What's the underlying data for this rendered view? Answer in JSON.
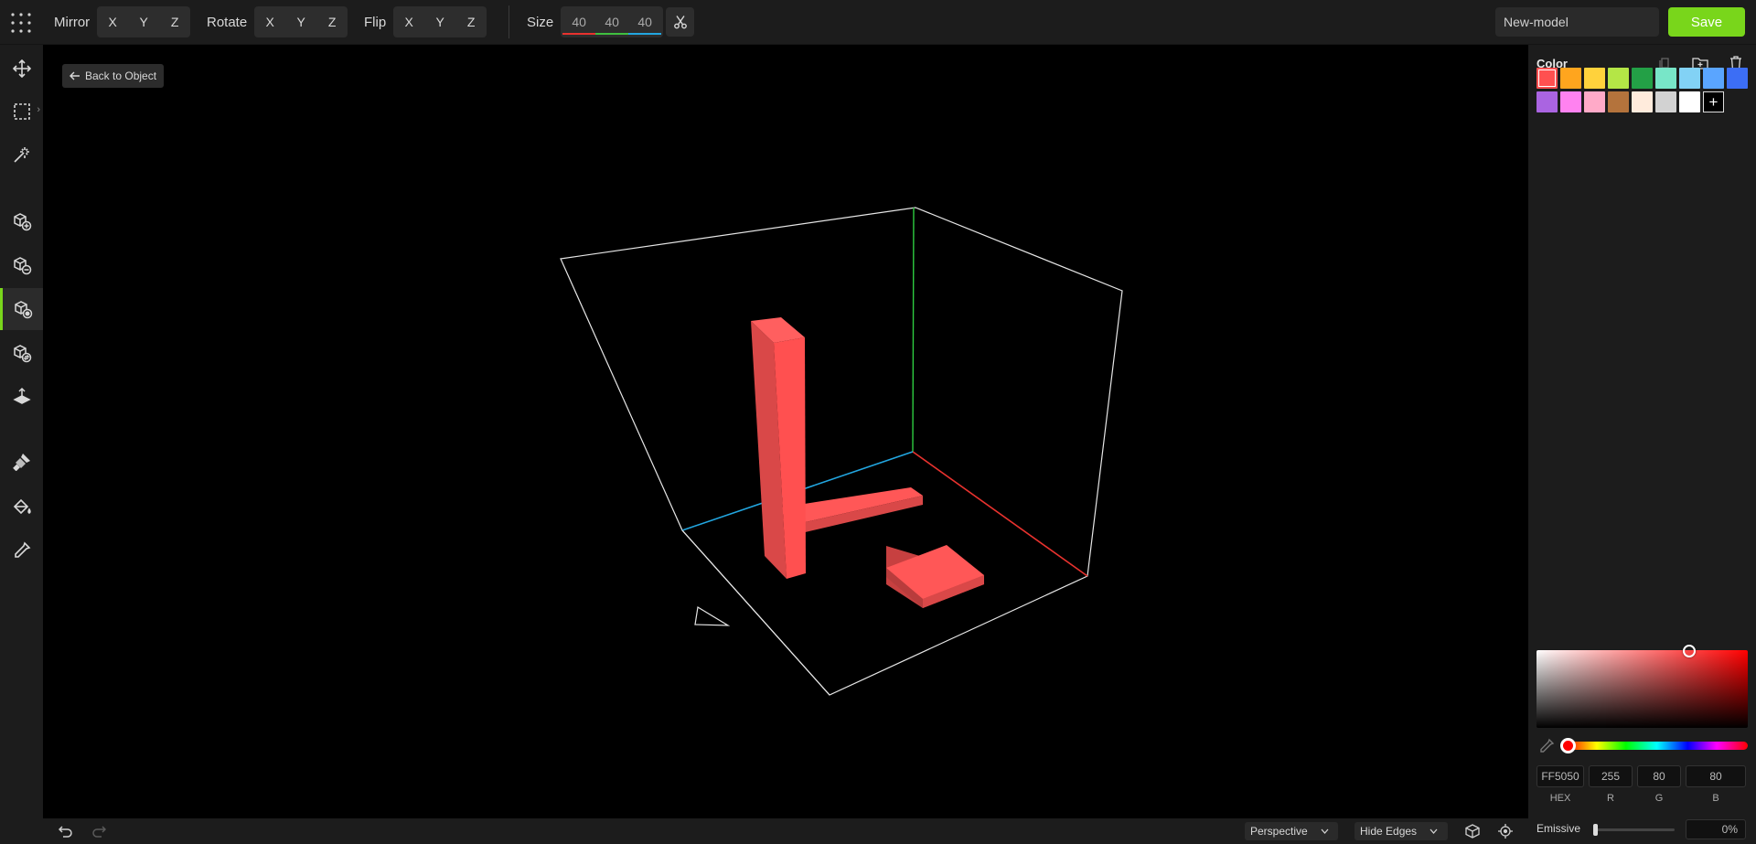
{
  "toolbar": {
    "mirror_label": "Mirror",
    "rotate_label": "Rotate",
    "flip_label": "Flip",
    "size_label": "Size",
    "axes": [
      "X",
      "Y",
      "Z"
    ],
    "size": {
      "x": "40",
      "y": "40",
      "z": "40"
    },
    "axis_colors": {
      "x": "#e8322e",
      "y": "#3fbf3f",
      "z": "#22a6e0"
    },
    "model_name": "New-model",
    "save_label": "Save"
  },
  "sidebar": {
    "tools": [
      {
        "icon": "move-icon"
      },
      {
        "icon": "select-box-icon"
      },
      {
        "icon": "magic-wand-icon"
      },
      {
        "icon": "add-voxel-icon"
      },
      {
        "icon": "remove-voxel-icon"
      },
      {
        "icon": "paint-voxel-icon",
        "active": true
      },
      {
        "icon": "replace-voxel-icon"
      },
      {
        "icon": "extrude-icon"
      },
      {
        "icon": "brush-icon"
      },
      {
        "icon": "fill-bucket-icon"
      },
      {
        "icon": "eyedropper-icon"
      }
    ]
  },
  "viewport": {
    "back_label": "Back to Object",
    "object_color": "#ff5050"
  },
  "bottombar": {
    "camera_mode": "Perspective",
    "edge_mode": "Hide Edges"
  },
  "panel": {
    "title": "Color",
    "swatches": [
      "#ff5050",
      "#ffa51e",
      "#ffd23c",
      "#b4e646",
      "#23a046",
      "#78e6c8",
      "#82d2f5",
      "#5aa5ff",
      "#3c6ef5",
      "#aa64e1",
      "#ff82f0",
      "#ffaac8",
      "#b4733c",
      "#ffebdc",
      "#d2d2d2",
      "#ffffff"
    ],
    "selected_index": 0,
    "hex": "FF5050",
    "r": "255",
    "g": "80",
    "b": "80",
    "hex_label": "HEX",
    "r_label": "R",
    "g_label": "G",
    "b_label": "B",
    "emissive_label": "Emissive",
    "emissive_value": "0%"
  }
}
